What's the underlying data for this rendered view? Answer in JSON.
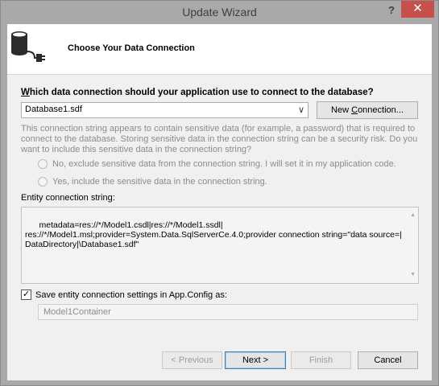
{
  "window": {
    "title": "Update Wizard",
    "help_label": "?",
    "close_label": "✕"
  },
  "header": {
    "title": "Choose Your Data Connection",
    "icon": "database-plug-icon"
  },
  "question": {
    "prefix": "W",
    "rest": "hich data connection should your application use to connect to the database?"
  },
  "connection": {
    "selected": "Database1.sdf",
    "new_button_prefix": "New ",
    "new_button_ul": "C",
    "new_button_rest": "onnection..."
  },
  "sensitive": {
    "text": "This connection string appears to contain sensitive data (for example, a password) that is required to connect to the database. Storing sensitive data in the connection string can be a security risk. Do you want to include this sensitive data in the connection string?",
    "option_no": "No, exclude sensitive data from the connection string. I will set it in my application code.",
    "option_yes": "Yes, include the sensitive data in the connection string."
  },
  "entity": {
    "label": "Entity connection string:",
    "value": "metadata=res://*/Model1.csdl|res://*/Model1.ssdl|\nres://*/Model1.msl;provider=System.Data.SqlServerCe.4.0;provider connection string=\"data source=|DataDirectory|\\Database1.sdf\""
  },
  "save": {
    "checked": true,
    "label": "Save entity connection settings in App.Config as:",
    "container_name": "Model1Container"
  },
  "buttons": {
    "previous": "< Previous",
    "next": "Next >",
    "finish": "Finish",
    "cancel": "Cancel"
  }
}
